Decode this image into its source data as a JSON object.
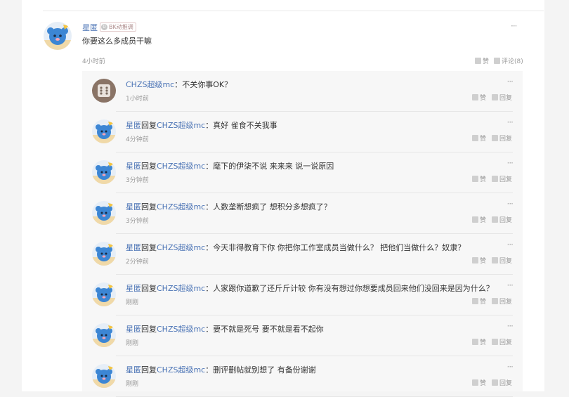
{
  "main_comment": {
    "username": "星匿",
    "level": "0",
    "level_label": "BK动推调",
    "content": "你要这么多成员干嘛",
    "time": "4小时前",
    "more": "···",
    "like_label": "赞",
    "comment_label": "评论(8)"
  },
  "reply_labels": {
    "like": "赞",
    "reply": "回复",
    "more": "···"
  },
  "replies": [
    {
      "author": "CHZS超级mc",
      "reply_word": "",
      "target": "",
      "sep": "：",
      "text": "不关你事OK？",
      "time": "1小时前"
    },
    {
      "author": "星匿",
      "reply_word": "回复",
      "target": "CHZS超级mc",
      "sep": "：",
      "text": "真好 雀食不关我事",
      "time": "4分钟前"
    },
    {
      "author": "星匿",
      "reply_word": "回复",
      "target": "CHZS超级mc",
      "sep": "：",
      "text": "麾下的伊柒不说 来来来 说一说原因",
      "time": "3分钟前"
    },
    {
      "author": "星匿",
      "reply_word": "回复",
      "target": "CHZS超级mc",
      "sep": "：",
      "text": "人数垄断想疯了 想积分多想疯了？",
      "time": "3分钟前"
    },
    {
      "author": "星匿",
      "reply_word": "回复",
      "target": "CHZS超级mc",
      "sep": "：",
      "text": "今天非得教育下你 你把你工作室成员当做什么？ 把他们当做什么？奴隶？",
      "time": "2分钟前"
    },
    {
      "author": "星匿",
      "reply_word": "回复",
      "target": "CHZS超级mc",
      "sep": "：",
      "text": "人家跟你道歉了还斤斤计较 你有没有想过你想要成员回来他们没回来是因为什么？",
      "time": "刚刚"
    },
    {
      "author": "星匿",
      "reply_word": "回复",
      "target": "CHZS超级mc",
      "sep": "：",
      "text": "要不就是死号 要不就是看不起你",
      "time": "刚刚"
    },
    {
      "author": "星匿",
      "reply_word": "回复",
      "target": "CHZS超级mc",
      "sep": "：",
      "text": "删评删帖就别想了 有备份谢谢",
      "time": "刚刚"
    }
  ]
}
